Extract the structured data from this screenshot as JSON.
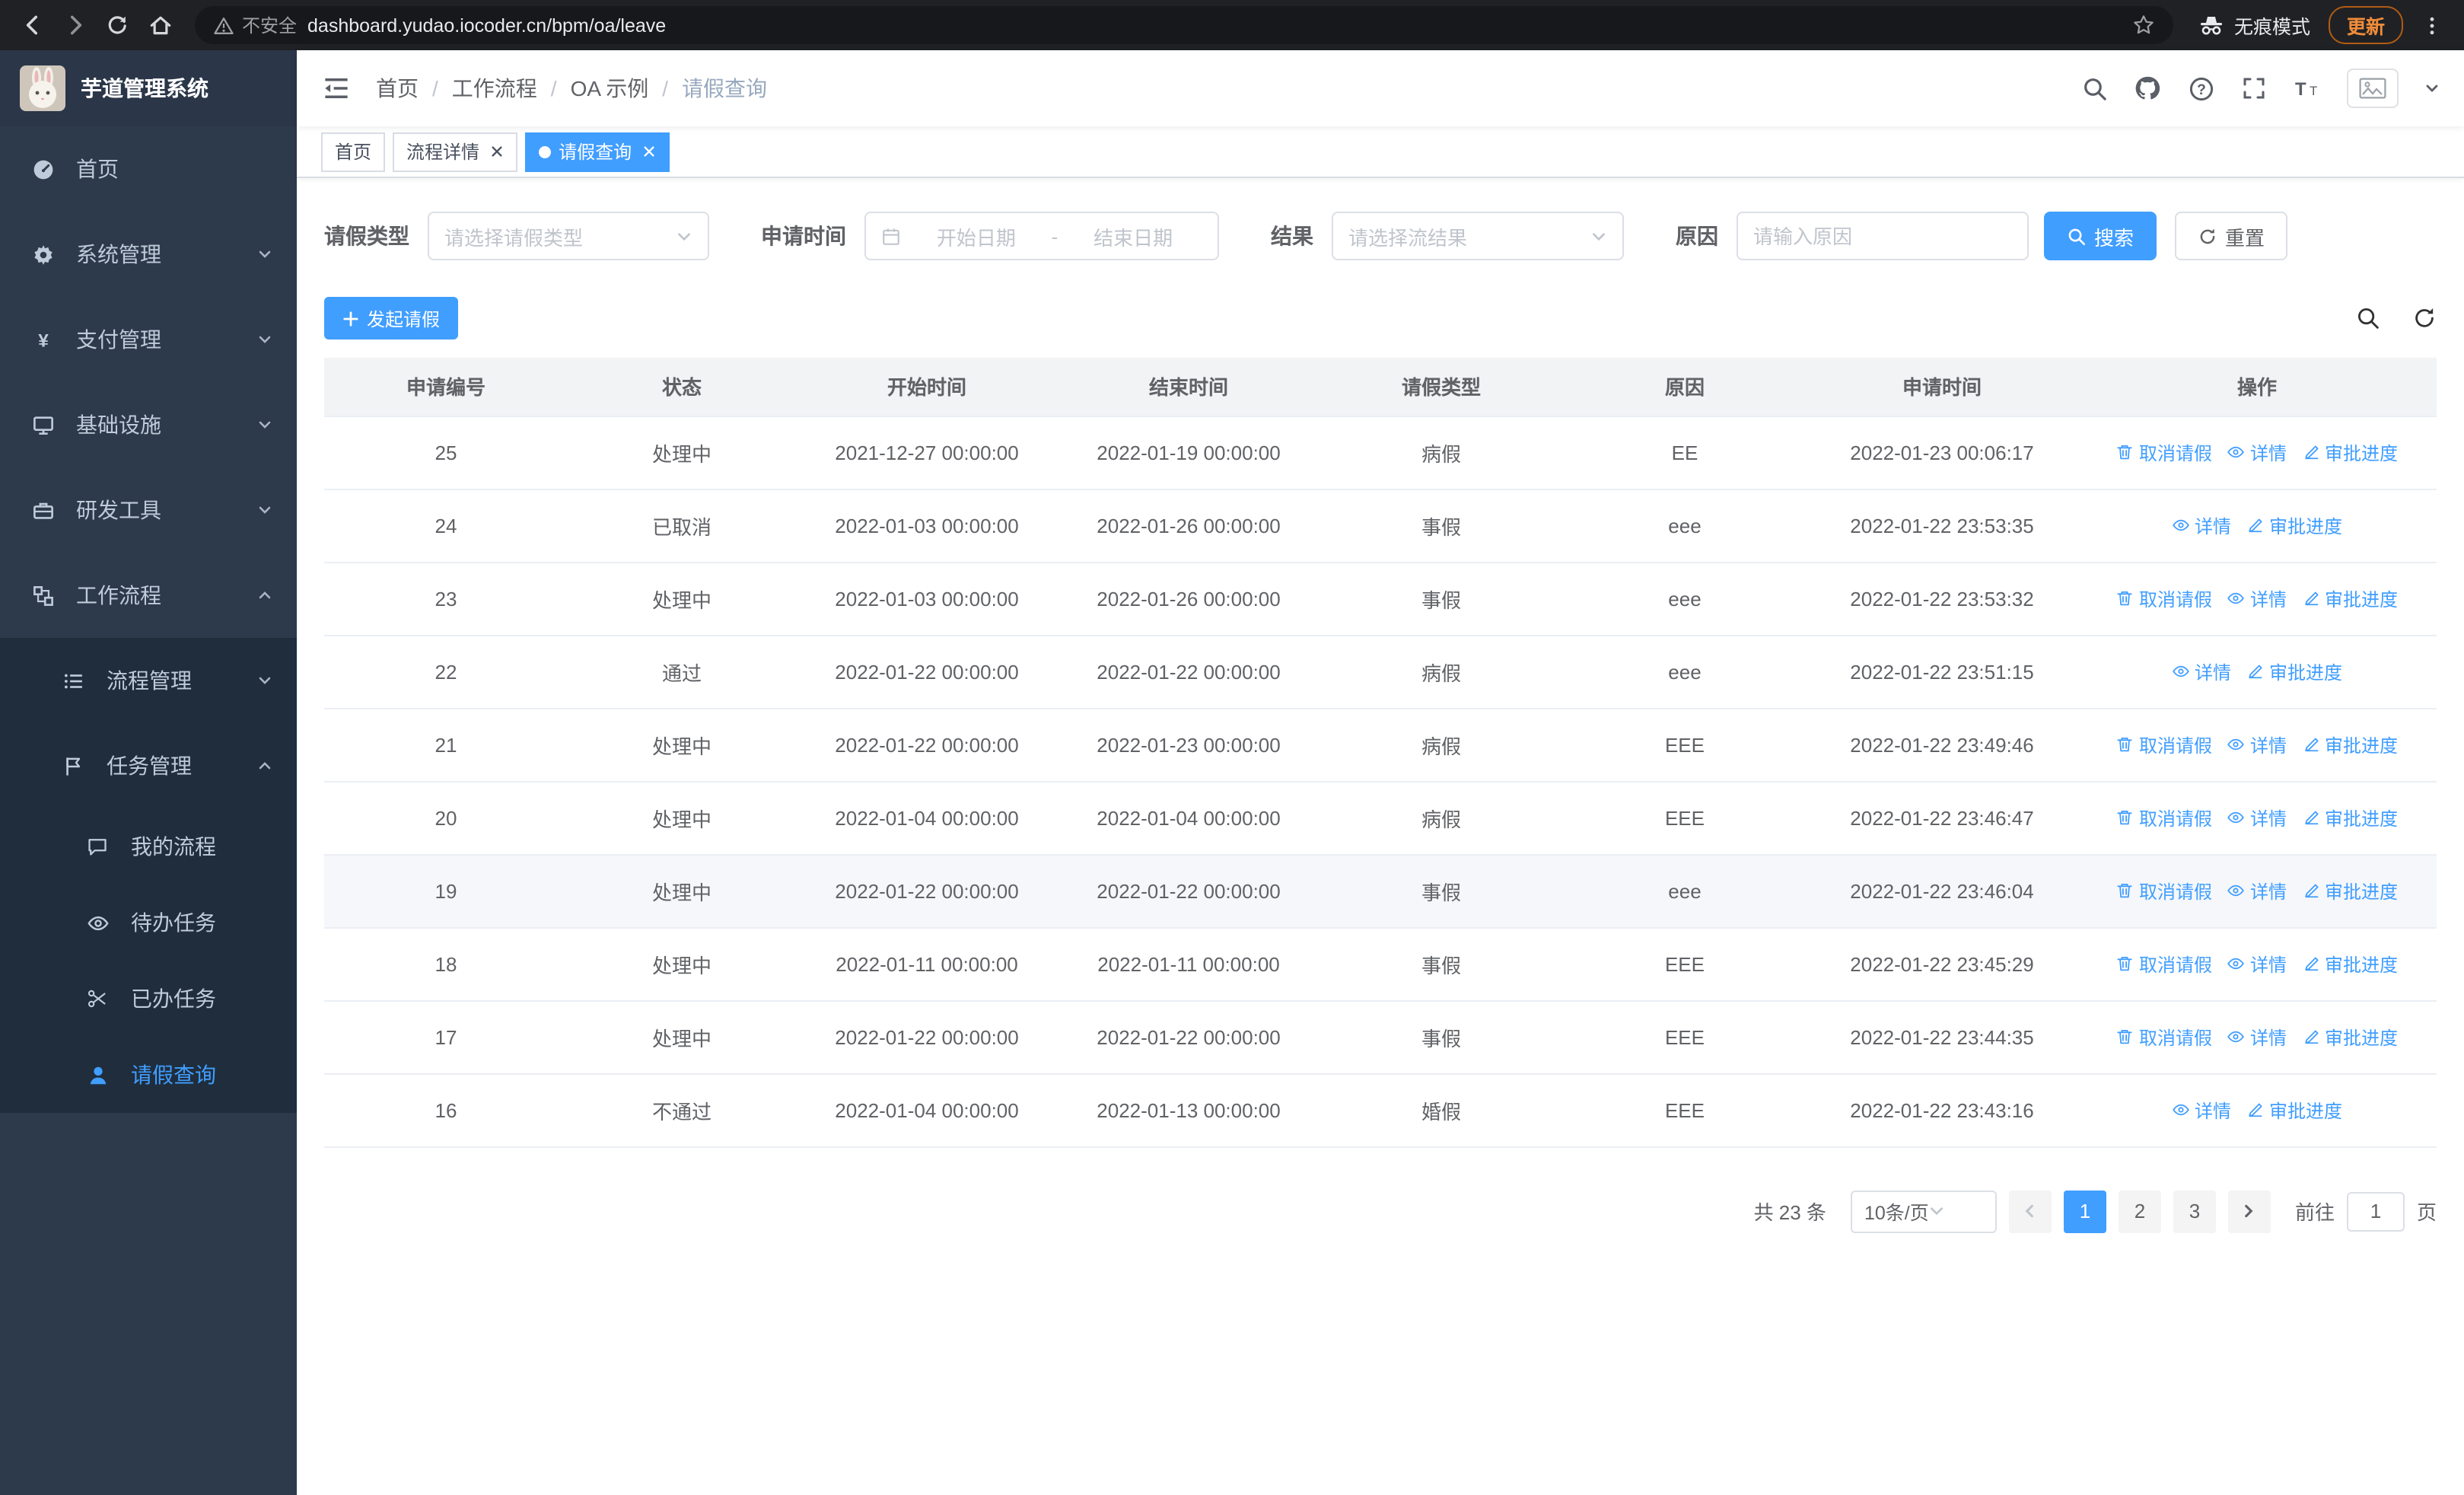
{
  "browser": {
    "security_label": "不安全",
    "url": "dashboard.yudao.iocoder.cn/bpm/oa/leave",
    "incognito_label": "无痕模式",
    "update_label": "更新"
  },
  "sidebar": {
    "logo_title": "芋道管理系统",
    "menu": [
      {
        "label": "首页"
      },
      {
        "label": "系统管理"
      },
      {
        "label": "支付管理"
      },
      {
        "label": "基础设施"
      },
      {
        "label": "研发工具"
      },
      {
        "label": "工作流程"
      }
    ],
    "workflow_children": [
      {
        "label": "流程管理"
      },
      {
        "label": "任务管理"
      }
    ],
    "task_children": [
      {
        "label": "我的流程"
      },
      {
        "label": "待办任务"
      },
      {
        "label": "已办任务"
      },
      {
        "label": "请假查询"
      }
    ]
  },
  "navbar": {
    "breadcrumb": [
      "首页",
      "工作流程",
      "OA 示例",
      "请假查询"
    ],
    "breadcrumb_separator": "/"
  },
  "tabs": [
    {
      "label": "首页"
    },
    {
      "label": "流程详情"
    },
    {
      "label": "请假查询"
    }
  ],
  "filters": {
    "leave_type_label": "请假类型",
    "leave_type_placeholder": "请选择请假类型",
    "apply_time_label": "申请时间",
    "start_date_placeholder": "开始日期",
    "range_separator": "-",
    "end_date_placeholder": "结束日期",
    "result_label": "结果",
    "result_placeholder": "请选择流结果",
    "reason_label": "原因",
    "reason_placeholder": "请输入原因",
    "search_button": "搜索",
    "reset_button": "重置"
  },
  "toolbar": {
    "create_button": "发起请假"
  },
  "table": {
    "columns": [
      "申请编号",
      "状态",
      "开始时间",
      "结束时间",
      "请假类型",
      "原因",
      "申请时间",
      "操作"
    ],
    "action_labels": {
      "cancel": "取消请假",
      "detail": "详情",
      "progress": "审批进度"
    },
    "rows": [
      {
        "id": "25",
        "status": "处理中",
        "start": "2021-12-27 00:00:00",
        "end": "2022-01-19 00:00:00",
        "type": "病假",
        "reason": "EE",
        "applied": "2022-01-23 00:06:17",
        "actions": [
          "cancel",
          "detail",
          "progress"
        ]
      },
      {
        "id": "24",
        "status": "已取消",
        "start": "2022-01-03 00:00:00",
        "end": "2022-01-26 00:00:00",
        "type": "事假",
        "reason": "eee",
        "applied": "2022-01-22 23:53:35",
        "actions": [
          "detail",
          "progress"
        ]
      },
      {
        "id": "23",
        "status": "处理中",
        "start": "2022-01-03 00:00:00",
        "end": "2022-01-26 00:00:00",
        "type": "事假",
        "reason": "eee",
        "applied": "2022-01-22 23:53:32",
        "actions": [
          "cancel",
          "detail",
          "progress"
        ]
      },
      {
        "id": "22",
        "status": "通过",
        "start": "2022-01-22 00:00:00",
        "end": "2022-01-22 00:00:00",
        "type": "病假",
        "reason": "eee",
        "applied": "2022-01-22 23:51:15",
        "actions": [
          "detail",
          "progress"
        ]
      },
      {
        "id": "21",
        "status": "处理中",
        "start": "2022-01-22 00:00:00",
        "end": "2022-01-23 00:00:00",
        "type": "病假",
        "reason": "EEE",
        "applied": "2022-01-22 23:49:46",
        "actions": [
          "cancel",
          "detail",
          "progress"
        ]
      },
      {
        "id": "20",
        "status": "处理中",
        "start": "2022-01-04 00:00:00",
        "end": "2022-01-04 00:00:00",
        "type": "病假",
        "reason": "EEE",
        "applied": "2022-01-22 23:46:47",
        "actions": [
          "cancel",
          "detail",
          "progress"
        ]
      },
      {
        "id": "19",
        "status": "处理中",
        "start": "2022-01-22 00:00:00",
        "end": "2022-01-22 00:00:00",
        "type": "事假",
        "reason": "eee",
        "applied": "2022-01-22 23:46:04",
        "actions": [
          "cancel",
          "detail",
          "progress"
        ],
        "highlighted": true
      },
      {
        "id": "18",
        "status": "处理中",
        "start": "2022-01-11 00:00:00",
        "end": "2022-01-11 00:00:00",
        "type": "事假",
        "reason": "EEE",
        "applied": "2022-01-22 23:45:29",
        "actions": [
          "cancel",
          "detail",
          "progress"
        ]
      },
      {
        "id": "17",
        "status": "处理中",
        "start": "2022-01-22 00:00:00",
        "end": "2022-01-22 00:00:00",
        "type": "事假",
        "reason": "EEE",
        "applied": "2022-01-22 23:44:35",
        "actions": [
          "cancel",
          "detail",
          "progress"
        ]
      },
      {
        "id": "16",
        "status": "不通过",
        "start": "2022-01-04 00:00:00",
        "end": "2022-01-13 00:00:00",
        "type": "婚假",
        "reason": "EEE",
        "applied": "2022-01-22 23:43:16",
        "actions": [
          "detail",
          "progress"
        ]
      }
    ]
  },
  "pagination": {
    "total_text": "共 23 条",
    "page_size": "10条/页",
    "pages": [
      "1",
      "2",
      "3"
    ],
    "active_page": "1",
    "goto_label": "前往",
    "goto_value": "1",
    "page_label": "页"
  },
  "icons": {
    "yen_glyph": "¥",
    "question_glyph": "?",
    "font_large_glyph": "T",
    "font_small_glyph": "T"
  },
  "colors": {
    "accent": "#409EFF",
    "sidebar_bg": "#2d3a4b",
    "submenu_bg": "#1f2d3d",
    "table_header_bg": "#f2f3f5"
  }
}
